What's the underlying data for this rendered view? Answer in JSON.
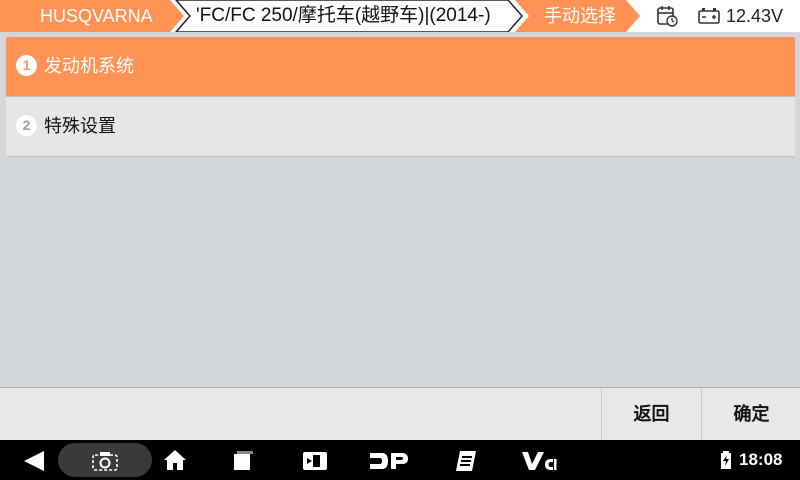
{
  "header": {
    "brand": "HUSQVARNA",
    "model": "'FC/FC 250/摩托车(越野车)|(2014-)",
    "mode": "手动选择",
    "voltage": "12.43V",
    "accent_color": "#ff9254"
  },
  "menu": {
    "items": [
      {
        "number": "1",
        "label": "发动机系统",
        "selected": true
      },
      {
        "number": "2",
        "label": "特殊设置",
        "selected": false
      }
    ]
  },
  "actions": {
    "back_label": "返回",
    "ok_label": "确定"
  },
  "status_bar": {
    "time": "18:08",
    "icons": [
      "back-icon",
      "screenshot-icon",
      "home-icon",
      "recents-icon",
      "display-icon",
      "dp-icon",
      "report-icon",
      "vci-icon",
      "wifi-icon",
      "battery-icon"
    ]
  }
}
